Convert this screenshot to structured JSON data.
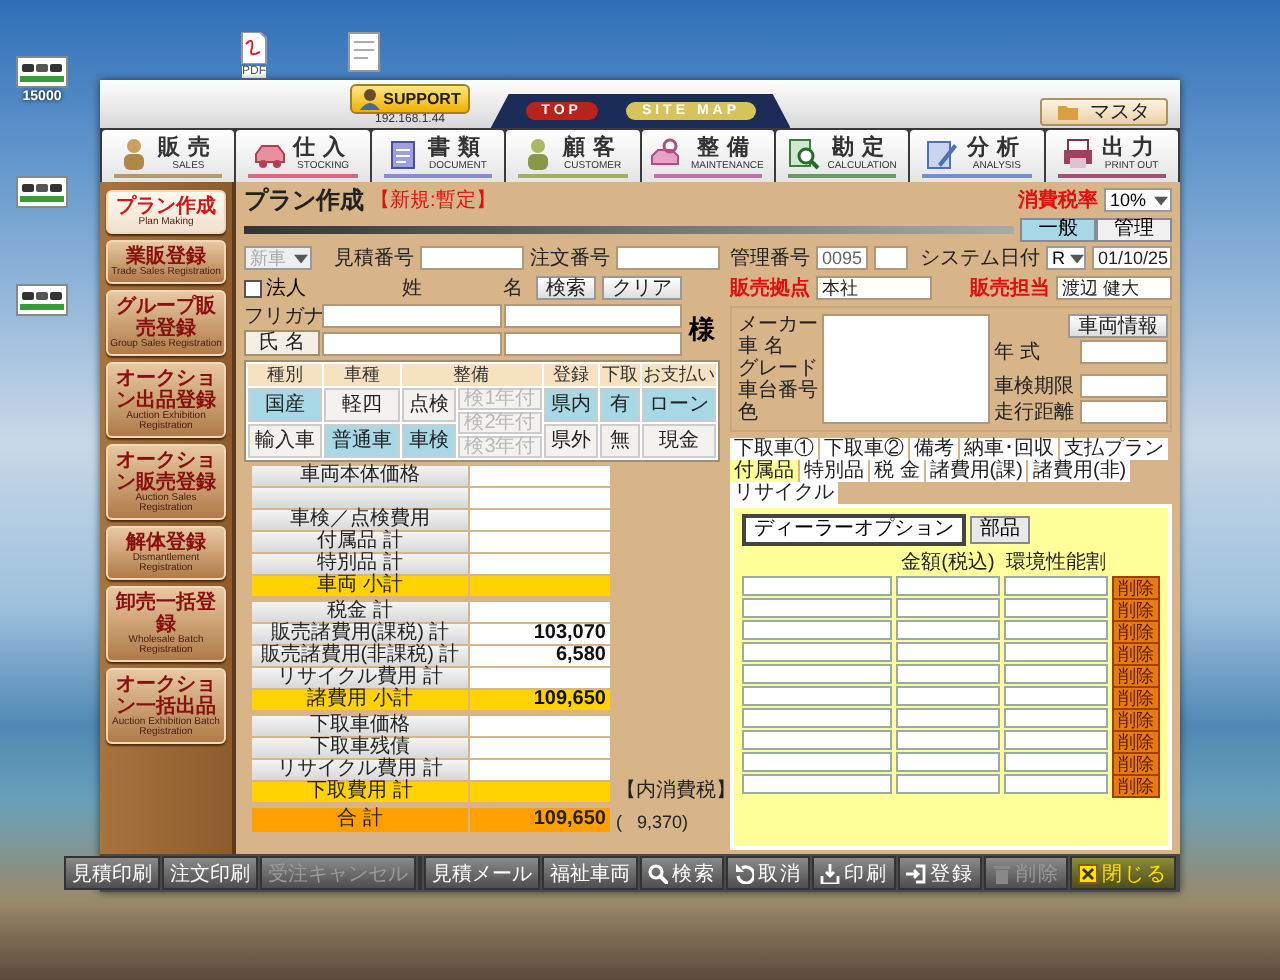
{
  "desktop_icons": [
    {
      "kind": "app",
      "label": "15000"
    },
    {
      "kind": "app"
    },
    {
      "kind": "app"
    },
    {
      "kind": "pdf",
      "label": "PDF"
    },
    {
      "kind": "doc"
    }
  ],
  "header": {
    "support_button": "SUPPORT",
    "ip_address": "192.168.1.44",
    "top_links": [
      {
        "label": "TOP",
        "color": "#b8241c"
      },
      {
        "label": "SITE MAP",
        "color": "#d6c45a"
      }
    ],
    "master_button": "マスタ"
  },
  "menu": [
    {
      "label": "販売",
      "sub": "SALES",
      "color": "#b89868"
    },
    {
      "label": "仕入",
      "sub": "STOCKING",
      "color": "#d86a7a"
    },
    {
      "label": "書類",
      "sub": "DOCUMENT",
      "color": "#8a8ad0"
    },
    {
      "label": "顧客",
      "sub": "CUSTOMER",
      "color": "#a0b060"
    },
    {
      "label": "整備",
      "sub": "MAINTENANCE",
      "color": "#c070b0"
    },
    {
      "label": "勘定",
      "sub": "CALCULATION",
      "color": "#60a060"
    },
    {
      "label": "分析",
      "sub": "ANALYSIS",
      "color": "#7090d0"
    },
    {
      "label": "出力",
      "sub": "PRINT OUT",
      "color": "#a05070"
    }
  ],
  "sidebar": [
    {
      "label": "プラン作成",
      "sub": "Plan Making",
      "selected": true
    },
    {
      "label": "業販登録",
      "sub": "Trade Sales Registration",
      "selected": false
    },
    {
      "label": "グループ販売登録",
      "sub": "Group Sales Registration",
      "selected": false
    },
    {
      "label": "オークション出品登録",
      "sub": "Auction Exhibition Registration",
      "selected": false
    },
    {
      "label": "オークション販売登録",
      "sub": "Auction Sales Registration",
      "selected": false
    },
    {
      "label": "解体登録",
      "sub": "Dismantlement Registration",
      "selected": false
    },
    {
      "label": "卸売一括登録",
      "sub": "Wholesale Batch Registration",
      "selected": false
    },
    {
      "label": "オークション一括出品",
      "sub": "Auction Exhibition Batch Registration",
      "selected": false
    }
  ],
  "form": {
    "title": "プラン作成",
    "status": "【新規:暫定】",
    "tax_rate_label": "消費税率",
    "tax_rate": "10%",
    "view_tabs": [
      {
        "label": "一般",
        "selected": true
      },
      {
        "label": "管理",
        "selected": false
      }
    ],
    "vehicle_class": {
      "value": "新車",
      "disabled": true
    },
    "estimate_no": {
      "label": "見積番号"
    },
    "order_no": {
      "label": "注文番号"
    },
    "management_no": {
      "label": "管理番号",
      "value": "0095"
    },
    "system_date": {
      "label": "システム日付",
      "era": "R",
      "value": "01/10/25"
    },
    "customer": {
      "corporate_label": "法人",
      "corporate": false,
      "surname_label": "姓",
      "given_label": "名",
      "search_button": "検索",
      "clear_button": "クリア",
      "kana_label": "フリガナ",
      "name_label": "氏 名",
      "honorific": "様"
    },
    "sales_base": {
      "label": "販売拠点",
      "value": "本社"
    },
    "sales_staff": {
      "label": "販売担当",
      "value": "渡辺 健大"
    },
    "options": [
      {
        "header": "種別",
        "items": [
          {
            "label": "国産",
            "selected": true
          },
          {
            "label": "輸入車",
            "selected": false
          }
        ]
      },
      {
        "header": "車種",
        "items": [
          {
            "label": "軽四",
            "selected": false
          },
          {
            "label": "普通車",
            "selected": true
          }
        ]
      },
      {
        "header": "整備",
        "items": [
          {
            "label": "点検",
            "selected": false
          },
          {
            "label": "車検",
            "selected": true
          }
        ],
        "extras": [
          {
            "label": "検1年付",
            "disabled": true
          },
          {
            "label": "検2年付",
            "disabled": true
          },
          {
            "label": "検3年付",
            "disabled": true
          }
        ]
      },
      {
        "header": "登録",
        "items": [
          {
            "label": "県内",
            "selected": true
          },
          {
            "label": "県外",
            "selected": false
          }
        ]
      },
      {
        "header": "下取",
        "items": [
          {
            "label": "有",
            "selected": true
          },
          {
            "label": "無",
            "selected": false
          }
        ]
      },
      {
        "header": "お支払い",
        "items": [
          {
            "label": "ローン",
            "selected": true
          },
          {
            "label": "現金",
            "selected": false
          }
        ]
      }
    ],
    "vehicle": {
      "labels": [
        "メーカー",
        "車 名",
        "グレード",
        "車台番号",
        "色"
      ],
      "info_button": "車両情報",
      "year_label": "年 式",
      "inspection_label": "車検期限",
      "mileage_label": "走行距離"
    },
    "costs": {
      "groups": [
        {
          "rows": [
            {
              "kind": "item",
              "label": "車両本体価格"
            },
            {
              "kind": "blank"
            },
            {
              "kind": "item",
              "label": "車検／点検費用"
            },
            {
              "kind": "item",
              "label": "付属品 計"
            },
            {
              "kind": "item",
              "label": "特別品 計"
            },
            {
              "kind": "subtotal",
              "label": "車両 小計"
            }
          ]
        },
        {
          "rows": [
            {
              "kind": "item",
              "label": "税金 計"
            },
            {
              "kind": "item",
              "label": "販売諸費用(課税) 計",
              "value": "103,070"
            },
            {
              "kind": "item",
              "label": "販売諸費用(非課税) 計",
              "value": "6,580"
            },
            {
              "kind": "item",
              "label": "リサイクル費用 計"
            },
            {
              "kind": "subtotal",
              "label": "諸費用 小計",
              "value": "109,650"
            }
          ]
        },
        {
          "rows": [
            {
              "kind": "item",
              "label": "下取車価格"
            },
            {
              "kind": "item",
              "label": "下取車残債"
            },
            {
              "kind": "item",
              "label": "リサイクル費用 計"
            },
            {
              "kind": "subtotal",
              "label": "下取費用 計"
            }
          ]
        }
      ],
      "total": {
        "label": "合 計",
        "value": "109,650"
      },
      "tax_note": {
        "label": "【内消費税】",
        "value": "(   9,370)"
      }
    },
    "panel": {
      "tab_rows": [
        {
          "tabs": [
            {
              "label": "下取車①",
              "selected": false
            },
            {
              "label": "下取車②",
              "selected": false
            },
            {
              "label": "備考",
              "selected": false
            },
            {
              "label": "納車･回収",
              "selected": false
            },
            {
              "label": "支払プラン",
              "selected": false
            }
          ]
        },
        {
          "tabs": [
            {
              "label": "付属品",
              "selected": true
            },
            {
              "label": "特別品",
              "selected": false
            },
            {
              "label": "税 金",
              "selected": false
            },
            {
              "label": "諸費用(課)",
              "selected": false
            },
            {
              "label": "諸費用(非)",
              "selected": false
            },
            {
              "label": "リサイクル",
              "selected": false
            }
          ]
        }
      ],
      "sub_tabs": [
        {
          "label": "ディーラーオプション",
          "selected": true
        },
        {
          "label": "部品",
          "selected": false
        }
      ],
      "columns": [
        "金額(税込)",
        "環境性能割"
      ],
      "rows": [
        {
          "delete_button": "削除"
        },
        {
          "delete_button": "削除"
        },
        {
          "delete_button": "削除"
        },
        {
          "delete_button": "削除"
        },
        {
          "delete_button": "削除"
        },
        {
          "delete_button": "削除"
        },
        {
          "delete_button": "削除"
        },
        {
          "delete_button": "削除"
        },
        {
          "delete_button": "削除"
        },
        {
          "delete_button": "削除"
        }
      ]
    }
  },
  "toolbar": [
    {
      "kind": "text",
      "label": "見積印刷",
      "disabled": false
    },
    {
      "kind": "text",
      "label": "注文印刷",
      "disabled": false
    },
    {
      "kind": "text",
      "label": "受注キャンセル",
      "disabled": true
    },
    {
      "kind": "blank"
    },
    {
      "kind": "text",
      "label": "見積メール",
      "disabled": false
    },
    {
      "kind": "text",
      "label": "福祉車両",
      "disabled": false
    },
    {
      "kind": "icon",
      "label": "検索",
      "disabled": false
    },
    {
      "kind": "icon",
      "label": "取消",
      "disabled": false
    },
    {
      "kind": "icon",
      "label": "印刷",
      "disabled": false
    },
    {
      "kind": "icon",
      "label": "登録",
      "disabled": false
    },
    {
      "kind": "icon",
      "label": "削除",
      "disabled": true
    },
    {
      "kind": "icon",
      "label": "閉じる",
      "disabled": false
    }
  ]
}
